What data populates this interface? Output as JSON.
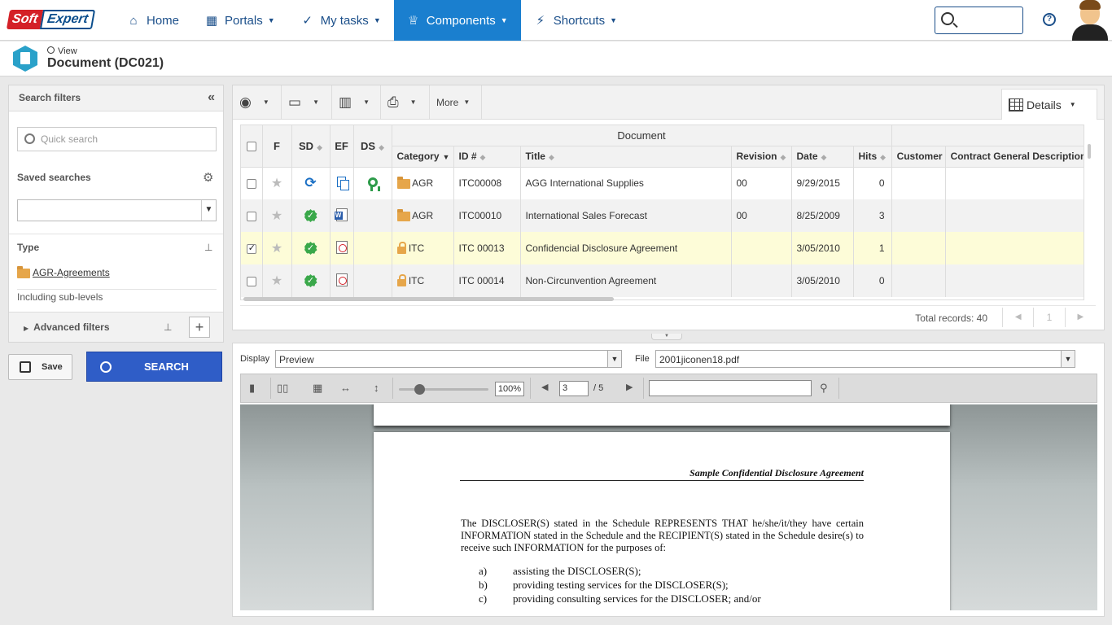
{
  "brand": {
    "part1": "Soft",
    "part2": "Expert"
  },
  "nav": [
    {
      "label": "Home",
      "icon": "home-icon",
      "glyph": "⌂",
      "caret": false,
      "active": false
    },
    {
      "label": "Portals",
      "icon": "portals-icon",
      "glyph": "▦",
      "caret": true,
      "active": false
    },
    {
      "label": "My tasks",
      "icon": "check-icon",
      "glyph": "✓",
      "caret": true,
      "active": false
    },
    {
      "label": "Components",
      "icon": "trophy-icon",
      "glyph": "♕",
      "caret": true,
      "active": true
    },
    {
      "label": "Shortcuts",
      "icon": "bolt-icon",
      "glyph": "⚡",
      "caret": true,
      "active": false
    }
  ],
  "header": {
    "view_label": "View",
    "title": "Document (DC021)"
  },
  "filters": {
    "title": "Search filters",
    "quick_search_placeholder": "Quick search",
    "saved_searches_label": "Saved searches",
    "saved_search_value": "",
    "type_label": "Type",
    "type_value": "AGR-Agreements",
    "sublevels_label": "Including sub-levels",
    "advanced_label": "Advanced filters"
  },
  "actions": {
    "save_label": "Save",
    "search_label": "SEARCH"
  },
  "toolbar": {
    "more_label": "More",
    "details_label": "Details"
  },
  "grid": {
    "group_header": "Document",
    "columns": {
      "f": "F",
      "sd": "SD",
      "ef": "EF",
      "ds": "DS",
      "category": "Category",
      "id": "ID #",
      "title": "Title",
      "revision": "Revision",
      "date": "Date",
      "hits": "Hits",
      "customer": "Customer",
      "contract": "Contract General Description"
    },
    "rows": [
      {
        "checked": false,
        "sd": "sync",
        "ef": "copy",
        "ds": "award",
        "cat_icon": "folder",
        "category": "AGR",
        "id": "ITC00008",
        "title": "AGG International Supplies",
        "revision": "00",
        "date": "9/29/2015",
        "hits": "0",
        "customer": "",
        "contract": ""
      },
      {
        "checked": false,
        "sd": "check",
        "ef": "word",
        "ds": "",
        "cat_icon": "folder",
        "category": "AGR",
        "id": "ITC00010",
        "title": "International Sales Forecast",
        "revision": "00",
        "date": "8/25/2009",
        "hits": "3",
        "customer": "",
        "contract": ""
      },
      {
        "checked": true,
        "sd": "check",
        "ef": "pdf",
        "ds": "",
        "cat_icon": "lock",
        "category": "ITC",
        "id": "ITC 00013",
        "title": "Confidencial Disclosure Agreement",
        "revision": "",
        "date": "3/05/2010",
        "hits": "1",
        "customer": "",
        "contract": ""
      },
      {
        "checked": false,
        "sd": "check",
        "ef": "pdf",
        "ds": "",
        "cat_icon": "lock",
        "category": "ITC",
        "id": "ITC 00014",
        "title": "Non-Circunvention Agreement",
        "revision": "",
        "date": "3/05/2010",
        "hits": "0",
        "customer": "",
        "contract": ""
      }
    ],
    "total_records": "Total records: 40",
    "page_number": "1"
  },
  "preview": {
    "display_label": "Display",
    "display_value": "Preview",
    "file_label": "File",
    "file_value": "2001jiconen18.pdf",
    "zoom": "100%",
    "page": "3",
    "page_total": "/ 5",
    "find_value": ""
  },
  "document": {
    "heading": "Sample Confidential Disclosure Agreement",
    "paragraph": "The DISCLOSER(S) stated in the Schedule REPRESENTS THAT he/she/it/they have certain INFORMATION stated in the Schedule and the RECIPIENT(S) stated in the Schedule desire(s) to receive such INFORMATION for the purposes of:",
    "items": [
      {
        "letter": "a)",
        "text": "assisting the DISCLOSER(S);"
      },
      {
        "letter": "b)",
        "text": "providing testing services for the DISCLOSER(S);"
      },
      {
        "letter": "c)",
        "text": "providing consulting services for the DISCLOSER;  and/or"
      }
    ]
  },
  "colors": {
    "accent": "#1a7fcf",
    "nav_text": "#1b4f8a",
    "search_button": "#2f5dc7",
    "selected_row": "#fdfcd8"
  }
}
